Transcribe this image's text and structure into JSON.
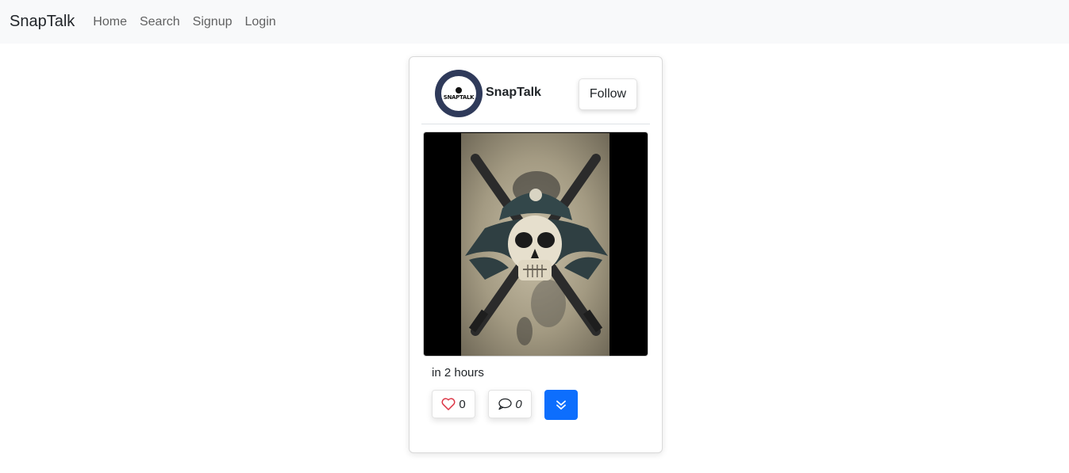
{
  "navbar": {
    "brand": "SnapTalk",
    "links": [
      {
        "label": "Home"
      },
      {
        "label": "Search"
      },
      {
        "label": "Signup"
      },
      {
        "label": "Login"
      }
    ]
  },
  "post": {
    "author": {
      "username": "SnapTalk",
      "avatar_text": "SNAPTALK"
    },
    "follow_label": "Follow",
    "image_description_icon": "pirate-skull-image",
    "timestamp": "in 2 hours",
    "likes": {
      "icon": "heart-icon",
      "count": "0"
    },
    "comments": {
      "icon": "chat-bubble-icon",
      "count": "0"
    },
    "expand_icon": "double-chevron-down-icon"
  },
  "colors": {
    "navbar_bg": "#f8f9fa",
    "primary": "#0d6efd",
    "heart": "#dc3545",
    "avatar_ring": "#2f3a5a"
  }
}
